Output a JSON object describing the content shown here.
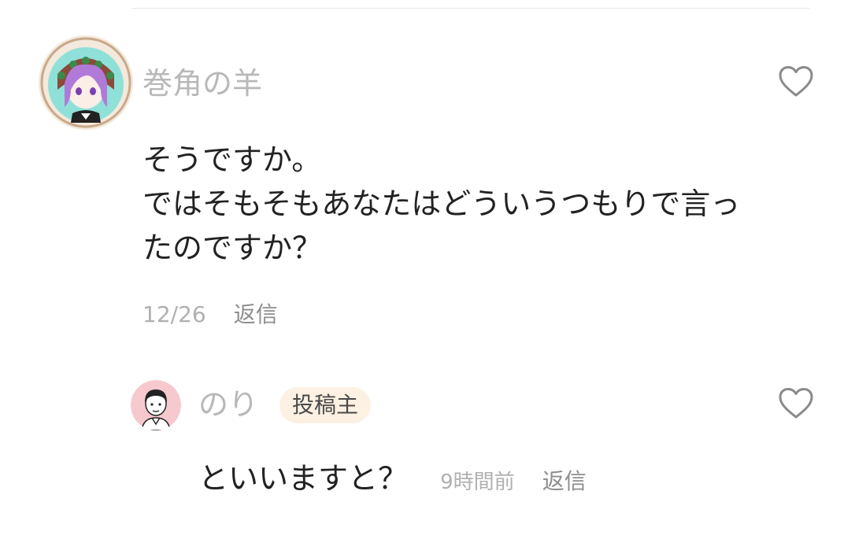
{
  "comment": {
    "username": "巻角の羊",
    "avatar_icon": "avatar-anime-girl-icon",
    "like_icon": "heart-outline-icon",
    "body_lines": [
      "そうですか。",
      "ではそもそもあなたはどういうつもりで言っ",
      "たのですか？"
    ],
    "date": "12/26",
    "reply_label": "返信"
  },
  "reply": {
    "username": "のり",
    "avatar_icon": "avatar-man-icon",
    "badge": "投稿主",
    "text": "といいますと？",
    "time": "9時間前",
    "reply_label": "返信",
    "like_icon": "heart-outline-icon"
  },
  "colors": {
    "username": "#b8b8b8",
    "body_text": "#222222",
    "meta_text": "#b0b0b0",
    "badge_bg": "#fdf1e3",
    "heart_stroke": "#8a8a8a"
  }
}
